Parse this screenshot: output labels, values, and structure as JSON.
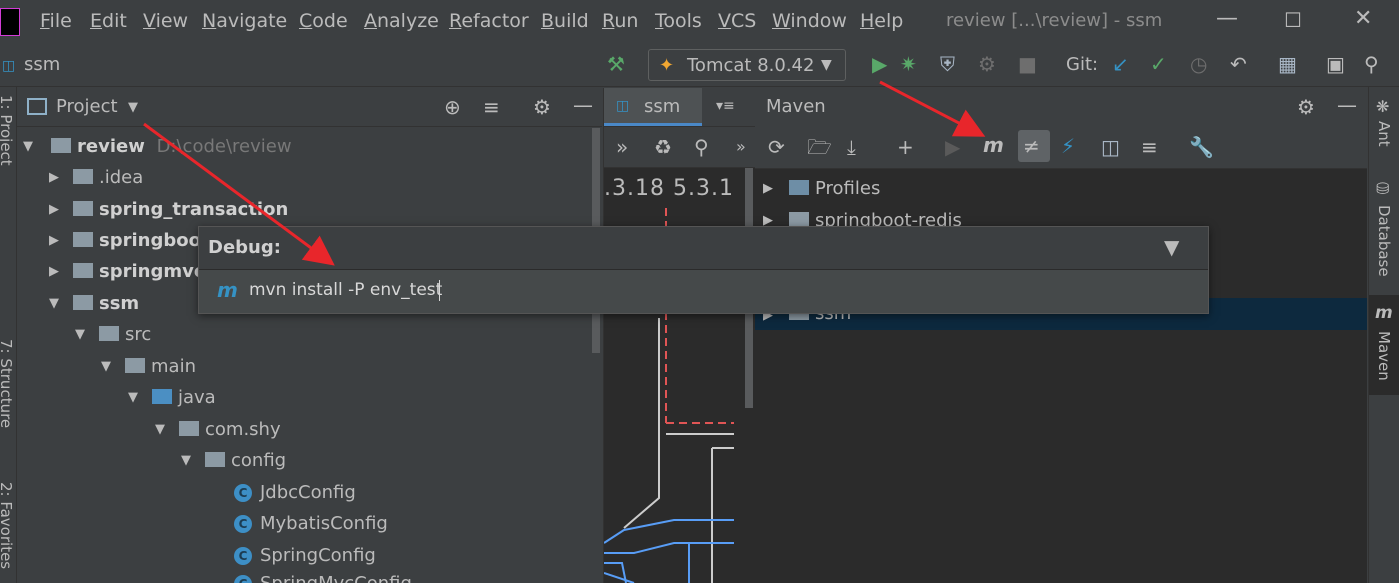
{
  "menubar": {
    "items": [
      "File",
      "Edit",
      "View",
      "Navigate",
      "Code",
      "Analyze",
      "Refactor",
      "Build",
      "Run",
      "Tools",
      "VCS",
      "Window",
      "Help"
    ],
    "window_title": "review [...\\review] - ssm"
  },
  "toolbar": {
    "project_name": "ssm",
    "run_config": "Tomcat 8.0.42",
    "git_label": "Git:"
  },
  "project_panel": {
    "title": "Project",
    "tree": [
      {
        "label": "review",
        "extra": "D:\\code\\review",
        "bold": true
      },
      {
        "label": ".idea"
      },
      {
        "label": "spring_transaction",
        "bold": true
      },
      {
        "label": "springboot",
        "bold": true
      },
      {
        "label": "springmvc",
        "bold": true
      },
      {
        "label": "ssm",
        "bold": true
      },
      {
        "label": "src"
      },
      {
        "label": "main"
      },
      {
        "label": "java"
      },
      {
        "label": "com.shy"
      },
      {
        "label": "config"
      },
      {
        "label": "JdbcConfig"
      },
      {
        "label": "MybatisConfig"
      },
      {
        "label": "SpringConfig"
      },
      {
        "label": "SpringMvcConfig"
      }
    ]
  },
  "git_panel": {
    "tab": "ssm",
    "version_text": ".3.18 5.3.1"
  },
  "maven_panel": {
    "title": "Maven",
    "tree": [
      "Profiles",
      "springboot-redis",
      "ssm"
    ]
  },
  "debug_popup": {
    "title": "Debug:",
    "command": "mvn install -P env_test"
  },
  "side_strips": {
    "left": [
      "1: Project",
      "7: Structure",
      "2: Favorites"
    ],
    "right": [
      "Ant",
      "Database",
      "Maven"
    ]
  },
  "colors": {
    "annotation_arrow": "#e8262b",
    "run_green": "#59a869",
    "maven_blue": "#3592c4"
  }
}
